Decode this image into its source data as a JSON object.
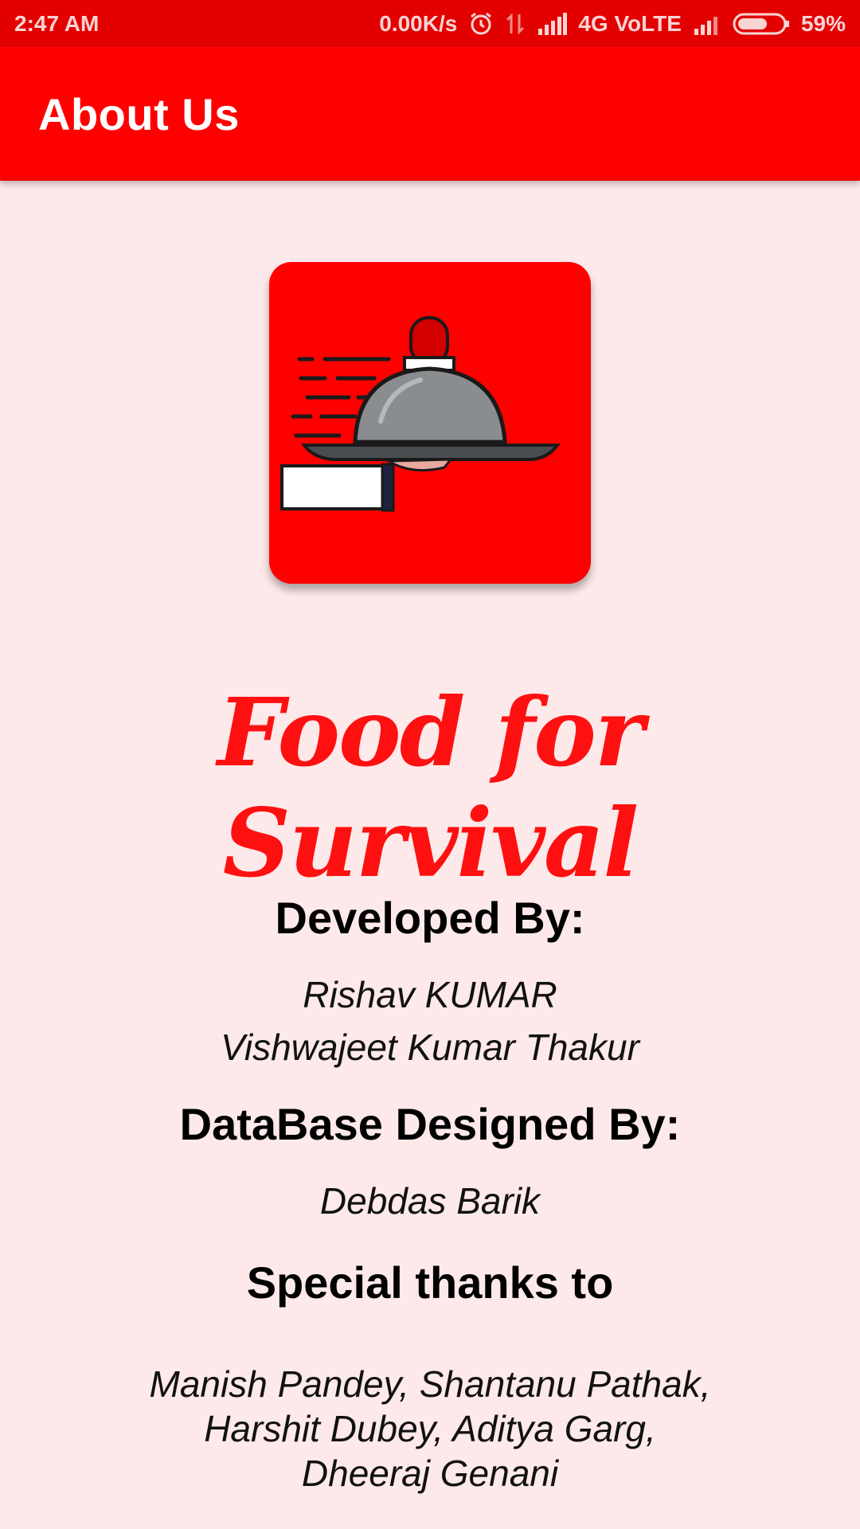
{
  "status_bar": {
    "time": "2:47 AM",
    "net_speed": "0.00K/s",
    "network_label": "4G VoLTE",
    "battery": "59%",
    "icons": [
      "alarm-icon",
      "data-transfer-icon",
      "signal-icon",
      "signal-icon-secondary",
      "battery-icon"
    ]
  },
  "app_bar": {
    "title": "About Us"
  },
  "logo": {
    "icon": "food-delivery-cloche-icon",
    "bg_color": "#ff0000"
  },
  "brand": {
    "title": "Food for Survival",
    "color": "#ff1010"
  },
  "developed": {
    "heading": "Developed By:",
    "names": [
      "Rishav KUMAR",
      "Vishwajeet Kumar Thakur"
    ]
  },
  "database": {
    "heading": "DataBase Designed By:",
    "names": [
      "Debdas Barik"
    ]
  },
  "thanks": {
    "heading": "Special thanks to",
    "lines": [
      "Manish Pandey, Shantanu Pathak,",
      "Harshit Dubey, Aditya Garg,",
      "Dheeraj Genani"
    ]
  },
  "colors": {
    "status_bar": "#e30000",
    "app_bar": "#ff0000",
    "background": "#fde9ea"
  }
}
